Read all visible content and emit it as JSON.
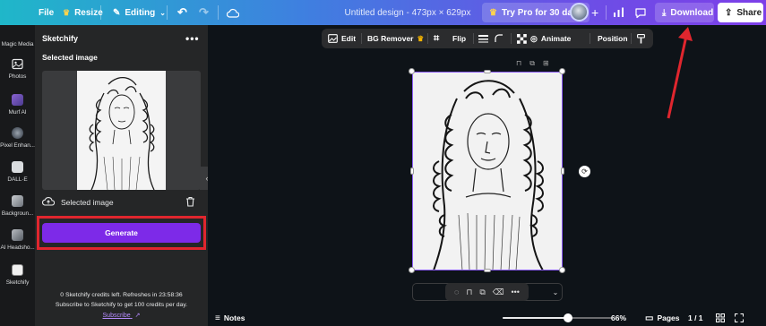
{
  "topbar": {
    "file": "File",
    "resize": "Resize",
    "editing": "Editing",
    "title": "Untitled design - 473px × 629px",
    "try_pro": "Try Pro for 30 days",
    "download": "Download",
    "share": "Share"
  },
  "rail": {
    "items": [
      {
        "label": "Magic Media",
        "icon": "magic-media-icon"
      },
      {
        "label": "Photos",
        "icon": "photos-icon"
      },
      {
        "label": "Murf AI",
        "icon": "murf-ai-icon"
      },
      {
        "label": "Pixel Enhan...",
        "icon": "pixel-enhancer-icon"
      },
      {
        "label": "DALL·E",
        "icon": "dalle-icon"
      },
      {
        "label": "Backgroun...",
        "icon": "background-icon"
      },
      {
        "label": "AI Headsho...",
        "icon": "ai-headshot-icon"
      },
      {
        "label": "Sketchify",
        "icon": "sketchify-icon"
      }
    ]
  },
  "panel": {
    "title": "Sketchify",
    "more": "•••",
    "selected_heading": "Selected image",
    "selected_label": "Selected image",
    "generate": "Generate",
    "credits_line1": "0 Sketchify credits left. Refreshes in  23:58:36",
    "credits_line2": "Subscribe to Sketchify to get 100 credits per day.",
    "subscribe": "Subscribe"
  },
  "context_bar": {
    "edit": "Edit",
    "bg_remover": "BG Remover",
    "flip": "Flip",
    "animate": "Animate",
    "position": "Position"
  },
  "bottombar": {
    "notes": "Notes",
    "zoom": "66%",
    "zoom_level": 0.6,
    "pages": "Pages",
    "page_count": "1 / 1"
  },
  "colors": {
    "accent": "#7d2ae8",
    "highlight": "#e0262e",
    "selection": "#8b5cf6"
  }
}
